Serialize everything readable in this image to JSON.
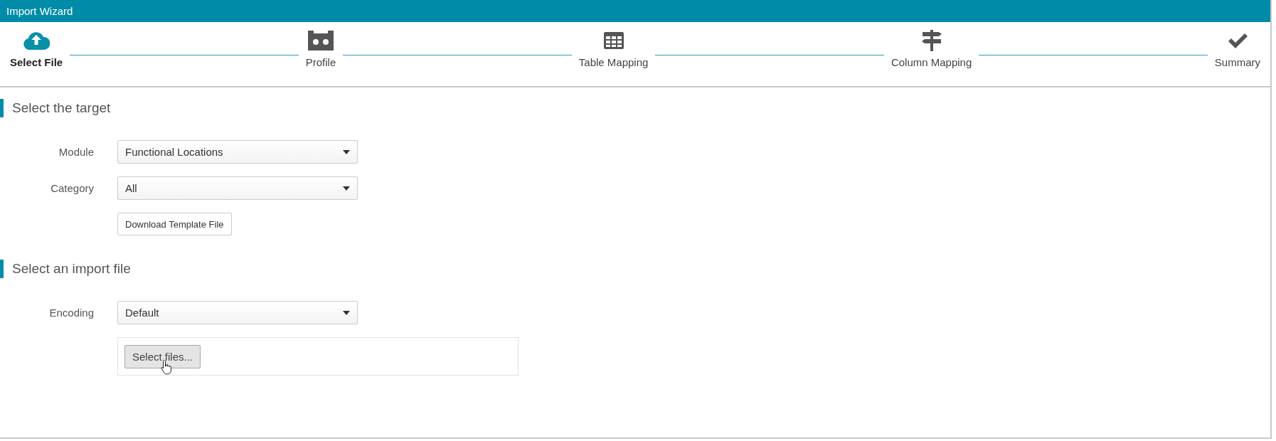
{
  "window": {
    "title": "Import Wizard"
  },
  "steps": [
    {
      "label": "Select File",
      "kind": "upload",
      "selected": true
    },
    {
      "label": "Profile",
      "kind": "profile",
      "selected": false
    },
    {
      "label": "Table Mapping",
      "kind": "table",
      "selected": false
    },
    {
      "label": "Column Mapping",
      "kind": "signpost",
      "selected": false
    },
    {
      "label": "Summary",
      "kind": "check",
      "selected": false
    }
  ],
  "sections": [
    {
      "title": "Select the target",
      "fields": [
        {
          "kind": "select",
          "label": "Module",
          "value": "Functional Locations"
        },
        {
          "kind": "select",
          "label": "Category",
          "value": "All"
        },
        {
          "kind": "button",
          "label": "Download Template File"
        }
      ]
    },
    {
      "title": "Select an import file",
      "fields": [
        {
          "kind": "select",
          "label": "Encoding",
          "value": "Default"
        },
        {
          "kind": "upload",
          "label": "Select files..."
        }
      ]
    }
  ]
}
